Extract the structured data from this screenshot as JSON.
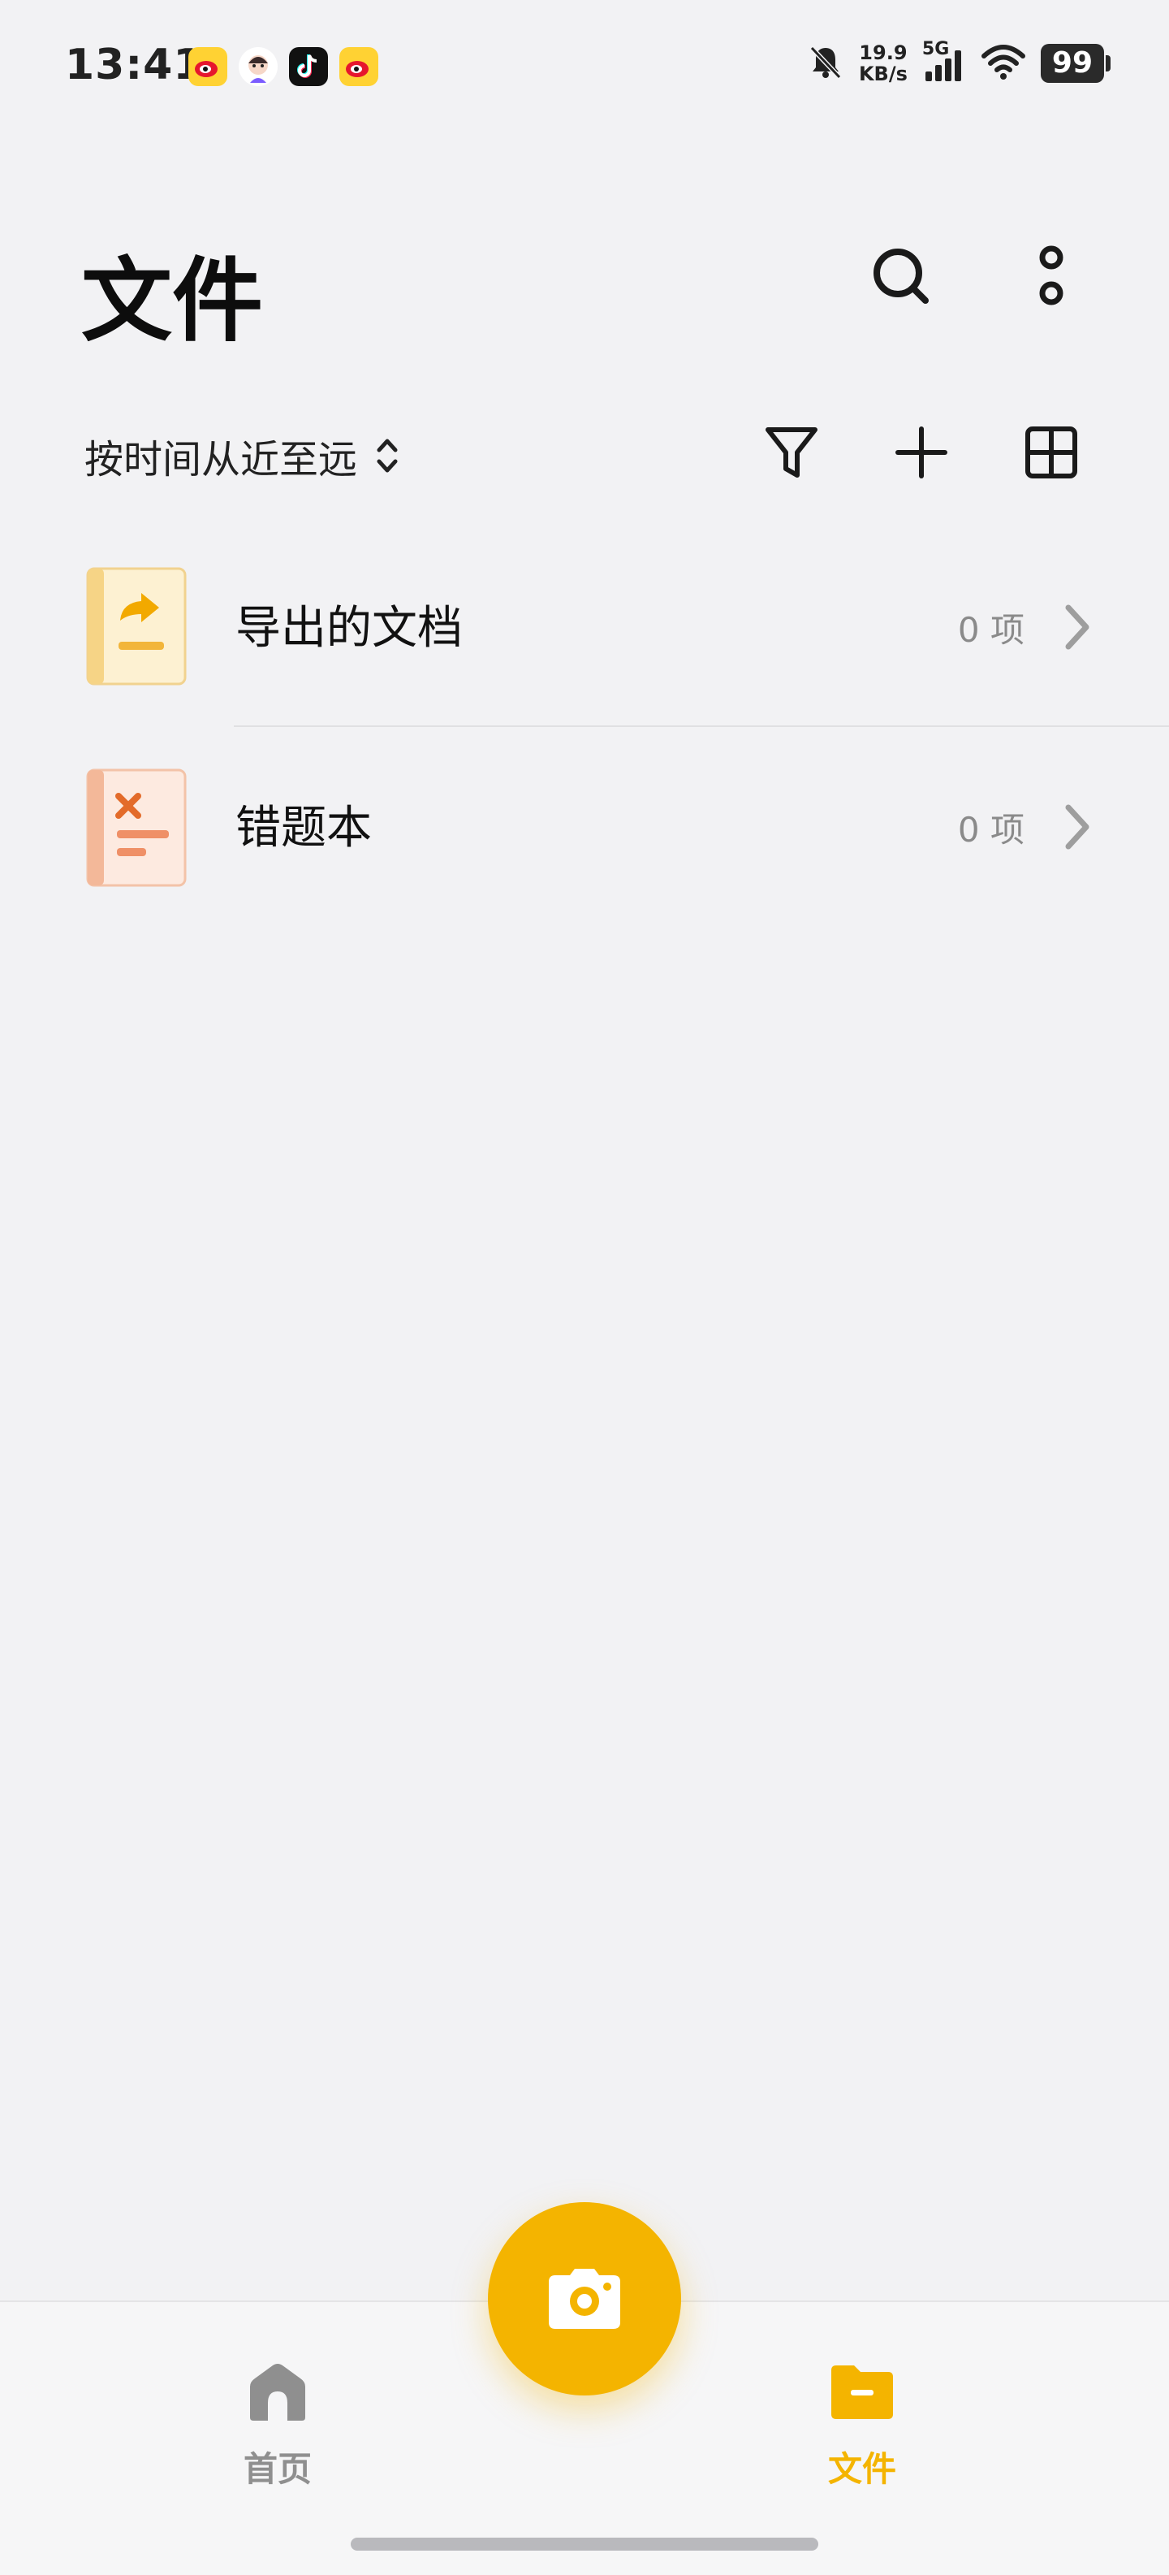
{
  "status_bar": {
    "time": "13:41",
    "net_speed_value": "19.9",
    "net_speed_unit": "KB/s",
    "network": "5G",
    "battery": "99",
    "app_icons": [
      "weibo-icon",
      "avatar-app-icon",
      "tiktok-icon",
      "weibo-icon"
    ]
  },
  "header": {
    "title": "文件",
    "icons": [
      "search-icon",
      "more-vertical-icon"
    ]
  },
  "toolbar": {
    "sort_label": "按时间从近至远",
    "icons": [
      "filter-icon",
      "add-icon",
      "grid-view-icon"
    ]
  },
  "list": {
    "items": [
      {
        "label": "导出的文档",
        "count": "0 项",
        "icon": "export-document-icon"
      },
      {
        "label": "错题本",
        "count": "0 项",
        "icon": "mistake-book-icon"
      }
    ]
  },
  "bottom_nav": {
    "home_label": "首页",
    "files_label": "文件",
    "active": "files",
    "fab_icon": "camera-icon"
  },
  "colors": {
    "accent": "#f4b400",
    "background": "#f2f2f4",
    "inactive_nav": "#8f8f8f",
    "text_primary": "#111111",
    "text_secondary": "#8a8a8a"
  }
}
